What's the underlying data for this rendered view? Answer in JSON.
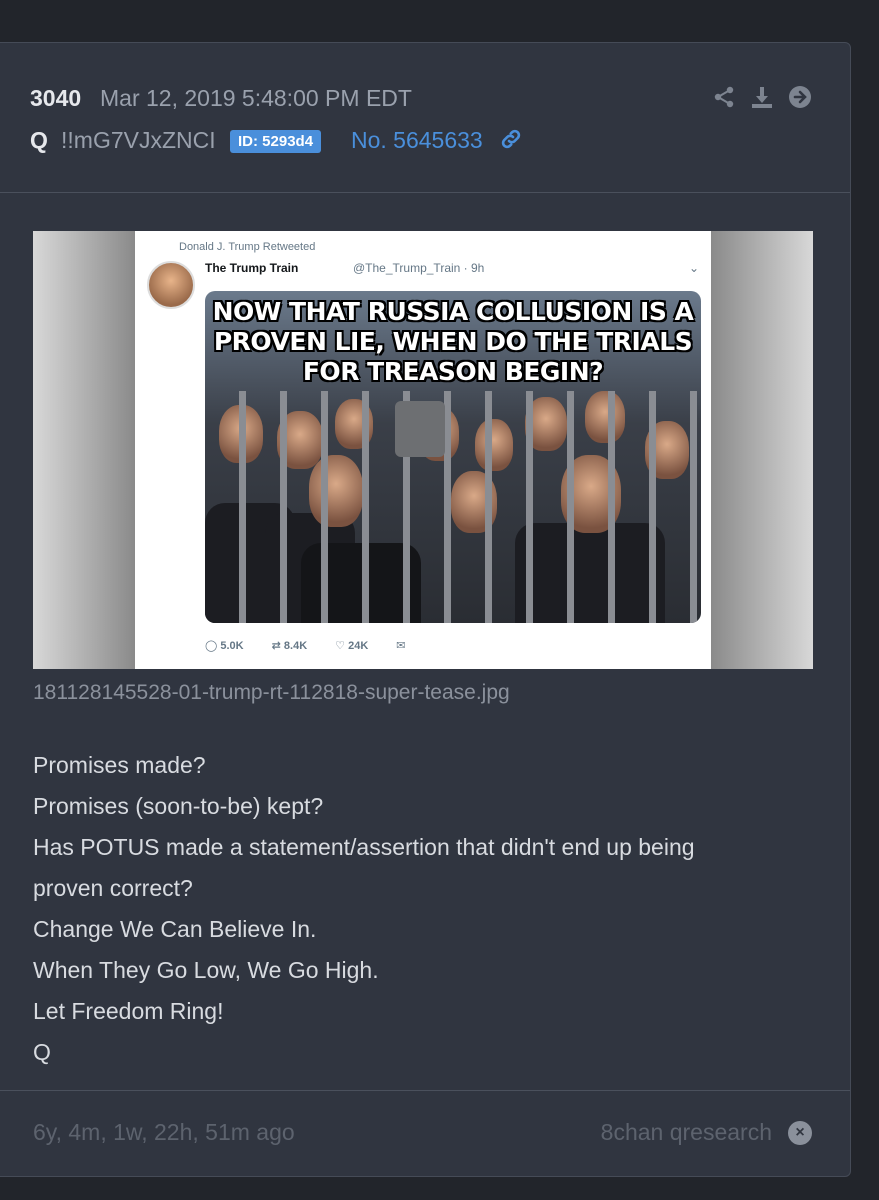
{
  "post": {
    "number": "3040",
    "date": "Mar 12, 2019 5:48:00 PM EDT",
    "author": "Q",
    "tripcode": "!!mG7VJxZNCI",
    "id_badge": "ID: 5293d4",
    "post_no": "No. 5645633"
  },
  "actions": [
    "share-icon",
    "download-icon",
    "arrow-right-icon"
  ],
  "image": {
    "filename": "181128145528-01-trump-rt-112818-super-tease.jpg",
    "tweet": {
      "retweeted_by": "Donald J. Trump Retweeted",
      "name": "The Trump Train",
      "handle": "@The_Trump_Train · 9h",
      "meme_text": "NOW THAT RUSSIA COLLUSION IS A PROVEN LIE, WHEN DO THE TRIALS FOR TREASON BEGIN?",
      "replies": "5.0K",
      "retweets": "8.4K",
      "likes": "24K"
    }
  },
  "body_lines": [
    "Promises made?",
    "Promises (soon-to-be) kept?",
    "Has POTUS made a statement/assertion that didn't end up being",
    "proven correct?",
    "Change We Can Believe In.",
    "When They Go Low, We Go High.",
    "Let Freedom Ring!",
    "Q"
  ],
  "footer": {
    "ago": "6y, 4m, 1w, 22h, 51m ago",
    "source": "8chan qresearch"
  },
  "colors": {
    "background": "#22252b",
    "card": "#303540",
    "accent": "#4a8fdb",
    "muted": "#9aa1ad"
  }
}
